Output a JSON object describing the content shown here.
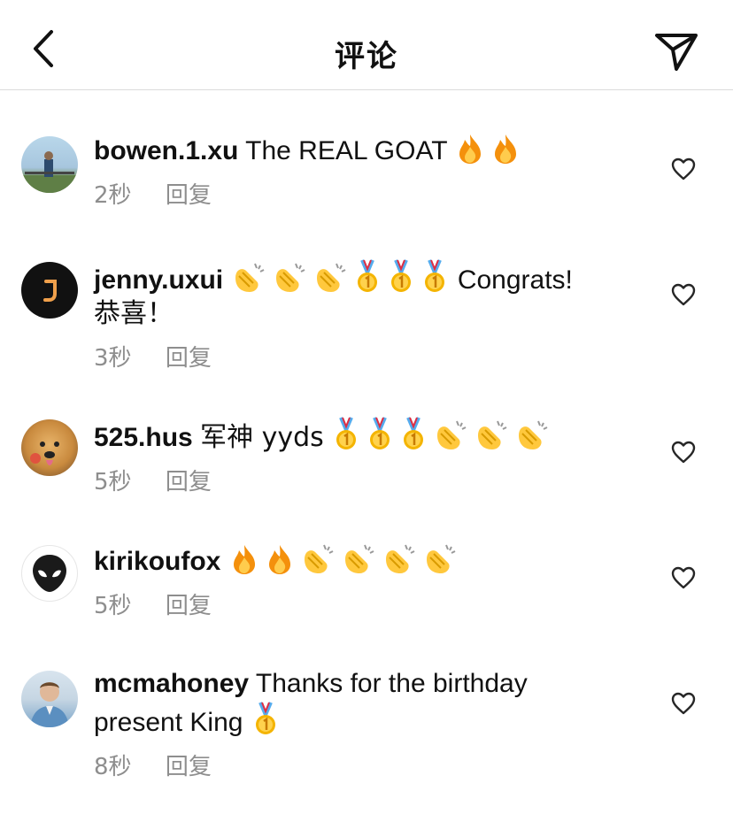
{
  "header": {
    "title": "评论"
  },
  "comments": [
    {
      "username": "bowen.1.xu",
      "text": "The REAL GOAT",
      "emojis": [
        "fire",
        "fire"
      ],
      "text_after": "",
      "second_line": "",
      "time": "2秒",
      "reply": "回复"
    },
    {
      "username": "jenny.uxui",
      "text": "",
      "emojis": [
        "clap",
        "clap",
        "clap",
        "medal",
        "medal",
        "medal"
      ],
      "text_after": "Congrats!",
      "second_line": "恭喜！",
      "time": "3秒",
      "reply": "回复"
    },
    {
      "username": "525.hus",
      "text": "军神 yyds",
      "emojis": [
        "medal",
        "medal",
        "medal",
        "clap",
        "clap",
        "clap"
      ],
      "text_after": "",
      "second_line": "",
      "time": "5秒",
      "reply": "回复"
    },
    {
      "username": "kirikoufox",
      "text": "",
      "emojis": [
        "fire",
        "fire",
        "clap",
        "clap",
        "clap",
        "clap"
      ],
      "text_after": "",
      "second_line": "",
      "time": "5秒",
      "reply": "回复"
    },
    {
      "username": "mcmahoney",
      "text": "Thanks for the birthday",
      "emojis": [],
      "text_after": "",
      "second_line": "present King",
      "second_line_emojis": [
        "medal"
      ],
      "time": "8秒",
      "reply": "回复"
    }
  ],
  "colors": {
    "meta": "#8e8e8e",
    "divider": "#dbdbdb",
    "text": "#111111"
  }
}
